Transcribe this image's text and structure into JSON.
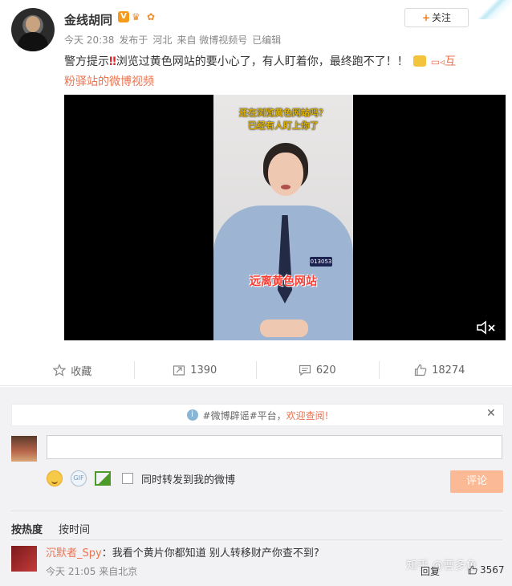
{
  "post": {
    "username": "金线胡同",
    "follow_label": "关注",
    "time": "今天 20:38",
    "posted_from_prefix": "发布于",
    "location": "河北",
    "source": "来自 微博视频号",
    "edited": "已编辑",
    "text_before": "警方提示",
    "text_main": "浏览过黄色网站的要小心了，有人盯着你，最终跑不了！！",
    "link_text_1": "互",
    "link_text_2": "粉驿站的微博视频"
  },
  "video": {
    "caption_top_1": "还在浏览黄色网站吗？",
    "caption_top_2": "已经有人盯上你了",
    "caption_bottom": "远离黄色网站",
    "badge_number": "013053"
  },
  "actions": {
    "favorite": "收藏",
    "repost": "1390",
    "comments": "620",
    "likes": "18274"
  },
  "notice": {
    "text": "#微博辟谣#平台，",
    "highlight": "欢迎查阅!"
  },
  "composer": {
    "placeholder": "",
    "sync_label": "同时转发到我的微博",
    "submit_label": "评论",
    "gif_label": "GIF"
  },
  "sort": {
    "hot": "按热度",
    "time": "按时间"
  },
  "comment": {
    "name": "沉默者_Spy",
    "text": "：我看个黄片你都知道 别人转移财产你查不到?",
    "time": "今天 21:05",
    "location": "来自北京",
    "reply": "回复",
    "likes": "3567"
  },
  "watermark": "知乎 @曹多鱼"
}
